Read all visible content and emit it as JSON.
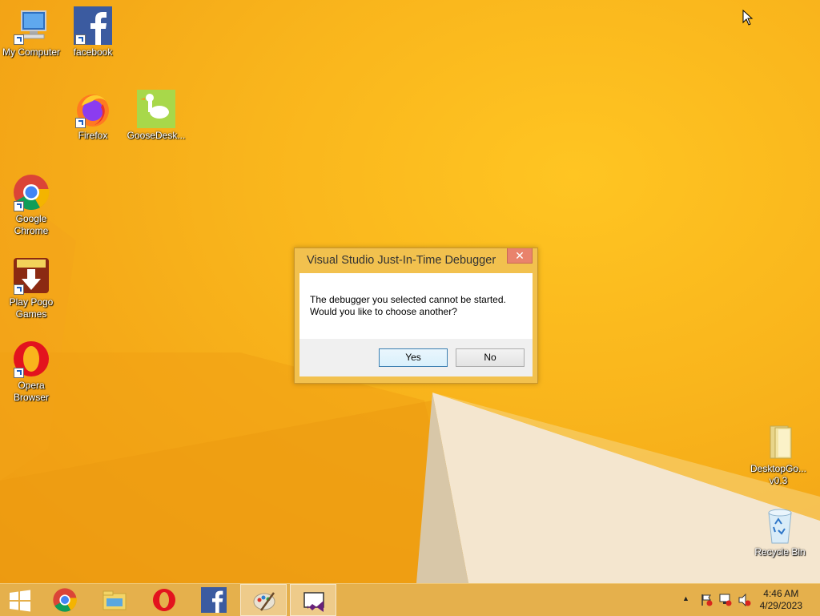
{
  "desktop": {
    "icons": [
      {
        "label": "My Computer"
      },
      {
        "label": "facebook"
      },
      {
        "label": "Firefox"
      },
      {
        "label": "GooseDesk..."
      },
      {
        "label": "Google Chrome"
      },
      {
        "label": "Play Pogo Games"
      },
      {
        "label": "Opera Browser"
      },
      {
        "label": "DesktopGo... v0.3"
      },
      {
        "label": "Recycle Bin"
      }
    ]
  },
  "dialog": {
    "title": "Visual Studio Just-In-Time Debugger",
    "close_glyph": "✕",
    "message_line1": "The debugger you selected cannot be started.",
    "message_line2": "Would you like to choose another?",
    "yes_label": "Yes",
    "no_label": "No"
  },
  "taskbar": {
    "items": [
      "start",
      "chrome",
      "file-explorer",
      "opera",
      "facebook",
      "paint",
      "visual-studio-debugger"
    ],
    "tray_chevron": "▲",
    "clock_time": "4:46 AM",
    "clock_date": "4/29/2023"
  }
}
